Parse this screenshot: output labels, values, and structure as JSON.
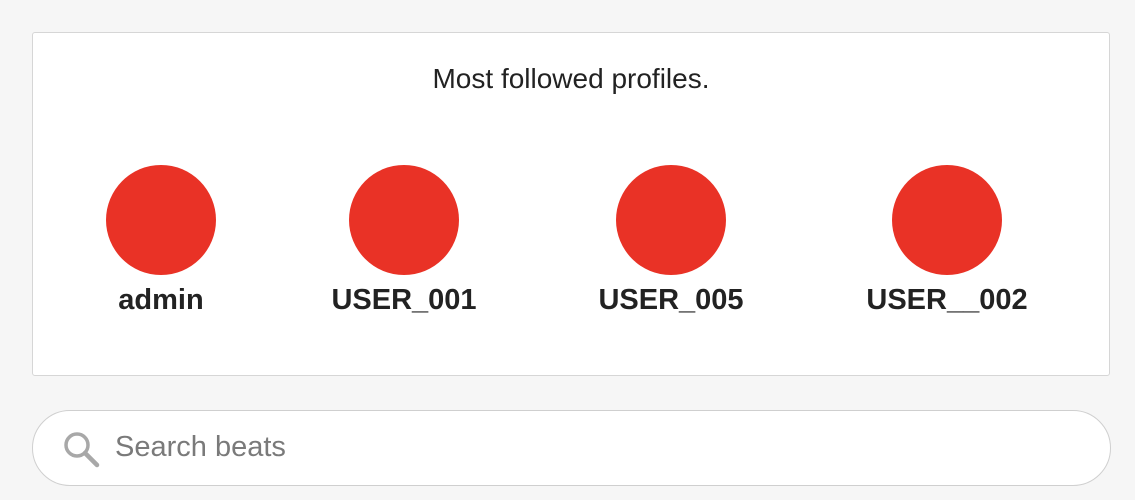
{
  "panel": {
    "title": "Most followed profiles."
  },
  "profiles": [
    {
      "username": "admin",
      "avatar_color": "#e93226"
    },
    {
      "username": "USER_001",
      "avatar_color": "#e93226"
    },
    {
      "username": "USER_005",
      "avatar_color": "#e93226"
    },
    {
      "username": "USER__002",
      "avatar_color": "#e93226"
    }
  ],
  "search": {
    "placeholder": "Search beats",
    "value": "",
    "icon": "search-icon"
  }
}
